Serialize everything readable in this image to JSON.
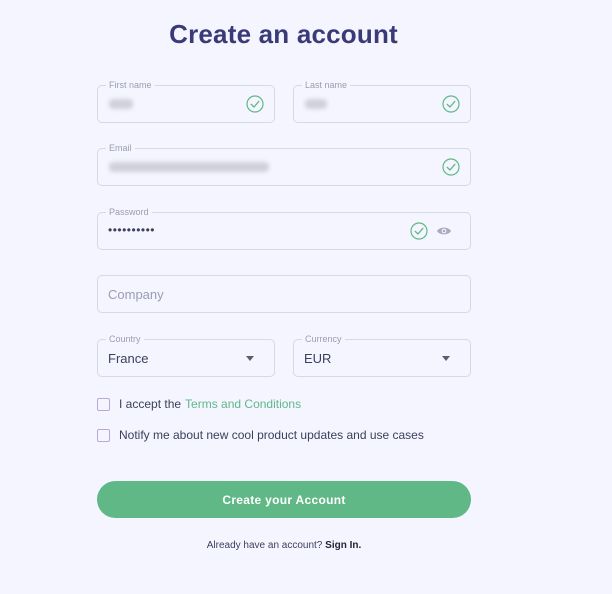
{
  "page": {
    "title": "Create an account"
  },
  "form": {
    "first_name": {
      "label": "First name"
    },
    "last_name": {
      "label": "Last name"
    },
    "email": {
      "label": "Email"
    },
    "password": {
      "label": "Password",
      "value": "••••••••••"
    },
    "company": {
      "placeholder": "Company"
    },
    "country": {
      "label": "Country",
      "value": "France"
    },
    "currency": {
      "label": "Currency",
      "value": "EUR"
    }
  },
  "checkboxes": {
    "terms": {
      "prefix": "I accept the",
      "link": "Terms and Conditions"
    },
    "notify": {
      "text": "Notify me about new cool product updates and use cases"
    }
  },
  "submit": {
    "label": "Create your Account"
  },
  "footer": {
    "prompt": "Already have an account?",
    "link": "Sign In."
  },
  "colors": {
    "accent": "#5fb886",
    "title": "#3b3a78",
    "background": "#f4f5fe"
  },
  "icons": {
    "valid": "check-circle-icon",
    "visibility": "eye-icon",
    "dropdown": "caret-down-icon"
  }
}
